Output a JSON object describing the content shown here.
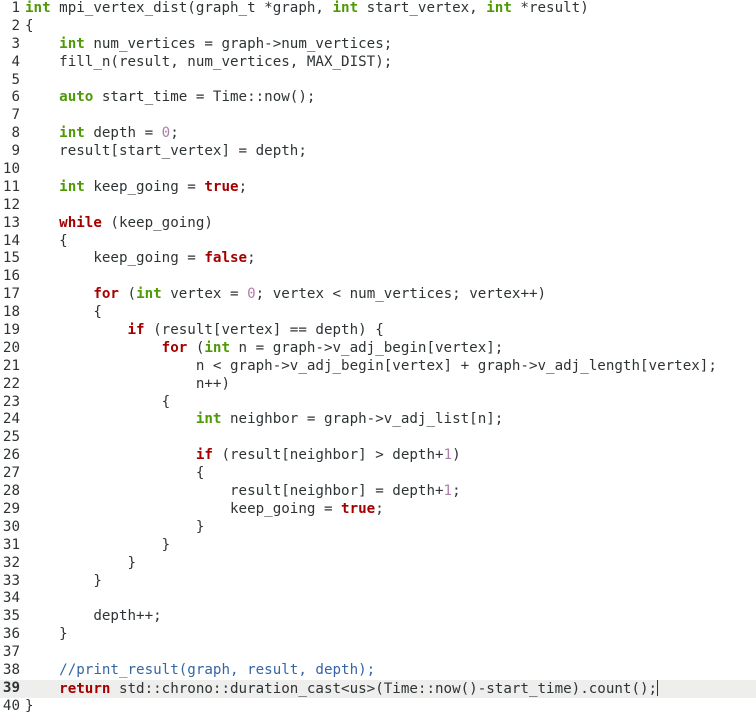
{
  "editor": {
    "current_line": 39,
    "colors": {
      "type_keyword": "#4e9a06",
      "control_keyword": "#a40000",
      "number": "#ad7fa8",
      "comment": "#3465a4",
      "text": "#2e3436",
      "current_line_bg": "#eeeeec"
    },
    "lines": [
      {
        "n": "1",
        "tokens": [
          [
            "t",
            "int"
          ],
          [
            "p",
            " mpi_vertex_dist(graph_t *graph, "
          ],
          [
            "t",
            "int"
          ],
          [
            "p",
            " start_vertex, "
          ],
          [
            "t",
            "int"
          ],
          [
            "p",
            " *result)"
          ]
        ]
      },
      {
        "n": "2",
        "tokens": [
          [
            "p",
            "{"
          ]
        ]
      },
      {
        "n": "3",
        "tokens": [
          [
            "p",
            "    "
          ],
          [
            "t",
            "int"
          ],
          [
            "p",
            " num_vertices = graph->num_vertices;"
          ]
        ]
      },
      {
        "n": "4",
        "tokens": [
          [
            "p",
            "    fill_n(result, num_vertices, MAX_DIST);"
          ]
        ]
      },
      {
        "n": "5",
        "tokens": []
      },
      {
        "n": "6",
        "tokens": [
          [
            "p",
            "    "
          ],
          [
            "t",
            "auto"
          ],
          [
            "p",
            " start_time = Time::now();"
          ]
        ]
      },
      {
        "n": "7",
        "tokens": []
      },
      {
        "n": "8",
        "tokens": [
          [
            "p",
            "    "
          ],
          [
            "t",
            "int"
          ],
          [
            "p",
            " depth = "
          ],
          [
            "n",
            "0"
          ],
          [
            "p",
            ";"
          ]
        ]
      },
      {
        "n": "9",
        "tokens": [
          [
            "p",
            "    result[start_vertex] = depth;"
          ]
        ]
      },
      {
        "n": "10",
        "tokens": []
      },
      {
        "n": "11",
        "tokens": [
          [
            "p",
            "    "
          ],
          [
            "t",
            "int"
          ],
          [
            "p",
            " keep_going = "
          ],
          [
            "c",
            "true"
          ],
          [
            "p",
            ";"
          ]
        ]
      },
      {
        "n": "12",
        "tokens": []
      },
      {
        "n": "13",
        "tokens": [
          [
            "p",
            "    "
          ],
          [
            "c",
            "while"
          ],
          [
            "p",
            " (keep_going)"
          ]
        ]
      },
      {
        "n": "14",
        "tokens": [
          [
            "p",
            "    {"
          ]
        ]
      },
      {
        "n": "15",
        "tokens": [
          [
            "p",
            "        keep_going = "
          ],
          [
            "c",
            "false"
          ],
          [
            "p",
            ";"
          ]
        ]
      },
      {
        "n": "16",
        "tokens": []
      },
      {
        "n": "17",
        "tokens": [
          [
            "p",
            "        "
          ],
          [
            "c",
            "for"
          ],
          [
            "p",
            " ("
          ],
          [
            "t",
            "int"
          ],
          [
            "p",
            " vertex = "
          ],
          [
            "n",
            "0"
          ],
          [
            "p",
            "; vertex < num_vertices; vertex++)"
          ]
        ]
      },
      {
        "n": "18",
        "tokens": [
          [
            "p",
            "        {"
          ]
        ]
      },
      {
        "n": "19",
        "tokens": [
          [
            "p",
            "            "
          ],
          [
            "c",
            "if"
          ],
          [
            "p",
            " (result[vertex] == depth) {"
          ]
        ]
      },
      {
        "n": "20",
        "tokens": [
          [
            "p",
            "                "
          ],
          [
            "c",
            "for"
          ],
          [
            "p",
            " ("
          ],
          [
            "t",
            "int"
          ],
          [
            "p",
            " n = graph->v_adj_begin[vertex];"
          ]
        ]
      },
      {
        "n": "21",
        "tokens": [
          [
            "p",
            "                    n < graph->v_adj_begin[vertex] + graph->v_adj_length[vertex];"
          ]
        ]
      },
      {
        "n": "22",
        "tokens": [
          [
            "p",
            "                    n++)"
          ]
        ]
      },
      {
        "n": "23",
        "tokens": [
          [
            "p",
            "                {"
          ]
        ]
      },
      {
        "n": "24",
        "tokens": [
          [
            "p",
            "                    "
          ],
          [
            "t",
            "int"
          ],
          [
            "p",
            " neighbor = graph->v_adj_list[n];"
          ]
        ]
      },
      {
        "n": "25",
        "tokens": []
      },
      {
        "n": "26",
        "tokens": [
          [
            "p",
            "                    "
          ],
          [
            "c",
            "if"
          ],
          [
            "p",
            " (result[neighbor] > depth+"
          ],
          [
            "n",
            "1"
          ],
          [
            "p",
            ")"
          ]
        ]
      },
      {
        "n": "27",
        "tokens": [
          [
            "p",
            "                    {"
          ]
        ]
      },
      {
        "n": "28",
        "tokens": [
          [
            "p",
            "                        result[neighbor] = depth+"
          ],
          [
            "n",
            "1"
          ],
          [
            "p",
            ";"
          ]
        ]
      },
      {
        "n": "29",
        "tokens": [
          [
            "p",
            "                        keep_going = "
          ],
          [
            "c",
            "true"
          ],
          [
            "p",
            ";"
          ]
        ]
      },
      {
        "n": "30",
        "tokens": [
          [
            "p",
            "                    }"
          ]
        ]
      },
      {
        "n": "31",
        "tokens": [
          [
            "p",
            "                }"
          ]
        ]
      },
      {
        "n": "32",
        "tokens": [
          [
            "p",
            "            }"
          ]
        ]
      },
      {
        "n": "33",
        "tokens": [
          [
            "p",
            "        }"
          ]
        ]
      },
      {
        "n": "34",
        "tokens": []
      },
      {
        "n": "35",
        "tokens": [
          [
            "p",
            "        depth++;"
          ]
        ]
      },
      {
        "n": "36",
        "tokens": [
          [
            "p",
            "    }"
          ]
        ]
      },
      {
        "n": "37",
        "tokens": []
      },
      {
        "n": "38",
        "tokens": [
          [
            "p",
            "    "
          ],
          [
            "m",
            "//print_result(graph, result, depth);"
          ]
        ]
      },
      {
        "n": "39",
        "tokens": [
          [
            "p",
            "    "
          ],
          [
            "c",
            "return"
          ],
          [
            "p",
            " std::chrono::duration_cast<us>(Time::now()-start_time).count();"
          ]
        ]
      },
      {
        "n": "40",
        "tokens": [
          [
            "p",
            "}"
          ]
        ]
      }
    ]
  }
}
